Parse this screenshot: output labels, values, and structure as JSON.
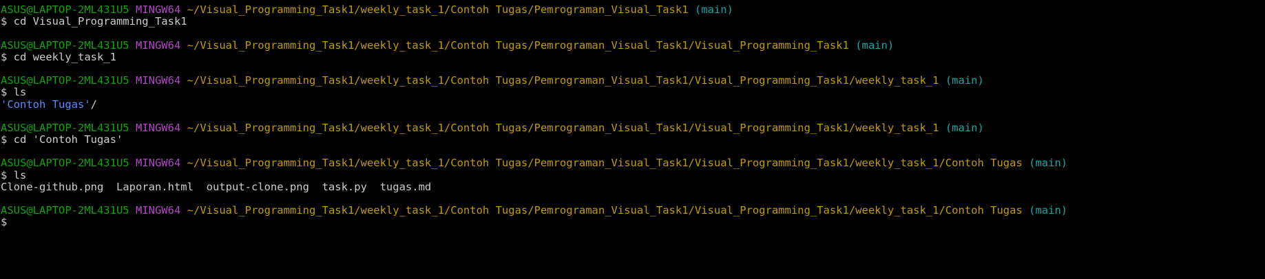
{
  "colors": {
    "user": "#13a10e",
    "system": "#b148c6",
    "path": "#c19c00",
    "branch": "#11a8a8",
    "directory": "#5b8cff",
    "text": "#cccccc",
    "background": "#000000"
  },
  "lines": [
    {
      "type": "prompt",
      "user": "ASUS@LAPTOP-2ML431U5",
      "system": "MINGW64",
      "path": "~/Visual_Programming_Task1/weekly_task_1/Contoh Tugas/Pemrograman_Visual_Task1",
      "branch": "(main)"
    },
    {
      "type": "command",
      "text": "$ cd Visual_Programming_Task1"
    },
    {
      "type": "blank"
    },
    {
      "type": "prompt",
      "user": "ASUS@LAPTOP-2ML431U5",
      "system": "MINGW64",
      "path": "~/Visual_Programming_Task1/weekly_task_1/Contoh Tugas/Pemrograman_Visual_Task1/Visual_Programming_Task1",
      "branch": "(main)"
    },
    {
      "type": "command",
      "text": "$ cd weekly_task_1"
    },
    {
      "type": "blank"
    },
    {
      "type": "prompt",
      "user": "ASUS@LAPTOP-2ML431U5",
      "system": "MINGW64",
      "path": "~/Visual_Programming_Task1/weekly_task_1/Contoh Tugas/Pemrograman_Visual_Task1/Visual_Programming_Task1/weekly_task_1",
      "branch": "(main)"
    },
    {
      "type": "command",
      "text": "$ ls"
    },
    {
      "type": "dir",
      "text": "'Contoh Tugas'",
      "suffix": "/"
    },
    {
      "type": "blank"
    },
    {
      "type": "prompt",
      "user": "ASUS@LAPTOP-2ML431U5",
      "system": "MINGW64",
      "path": "~/Visual_Programming_Task1/weekly_task_1/Contoh Tugas/Pemrograman_Visual_Task1/Visual_Programming_Task1/weekly_task_1",
      "branch": "(main)"
    },
    {
      "type": "command",
      "text": "$ cd 'Contoh Tugas'"
    },
    {
      "type": "blank"
    },
    {
      "type": "prompt",
      "user": "ASUS@LAPTOP-2ML431U5",
      "system": "MINGW64",
      "path": "~/Visual_Programming_Task1/weekly_task_1/Contoh Tugas/Pemrograman_Visual_Task1/Visual_Programming_Task1/weekly_task_1/Contoh Tugas",
      "branch": "(main)"
    },
    {
      "type": "command",
      "text": "$ ls"
    },
    {
      "type": "output",
      "text": "Clone-github.png  Laporan.html  output-clone.png  task.py  tugas.md"
    },
    {
      "type": "blank"
    },
    {
      "type": "prompt",
      "user": "ASUS@LAPTOP-2ML431U5",
      "system": "MINGW64",
      "path": "~/Visual_Programming_Task1/weekly_task_1/Contoh Tugas/Pemrograman_Visual_Task1/Visual_Programming_Task1/weekly_task_1/Contoh Tugas",
      "branch": "(main)"
    },
    {
      "type": "command",
      "text": "$"
    }
  ]
}
